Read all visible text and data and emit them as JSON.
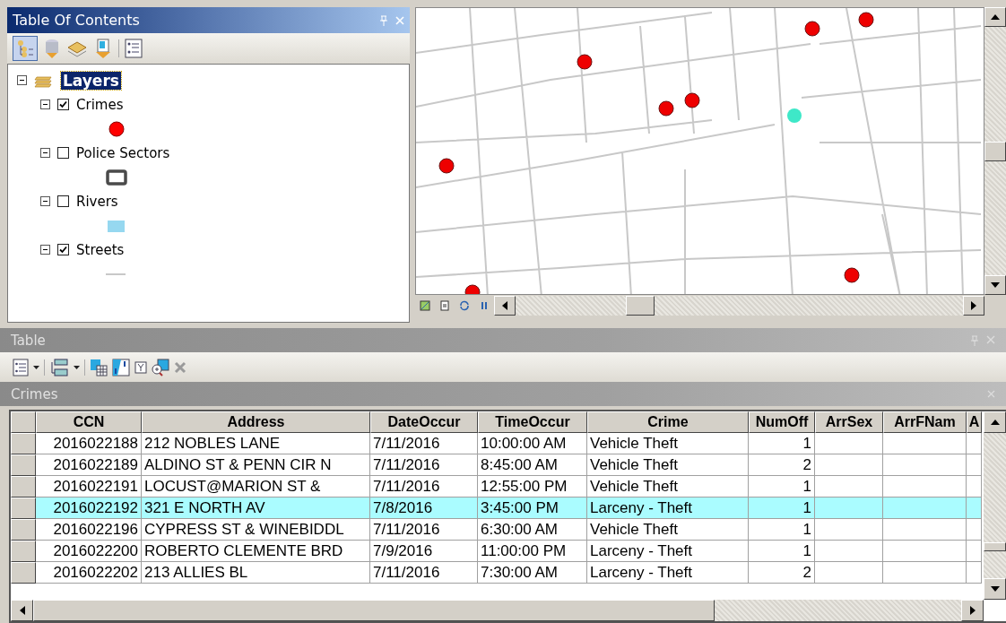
{
  "toc": {
    "title": "Table Of Contents",
    "root": {
      "label": "Layers",
      "selected": true,
      "expanded": true,
      "children": [
        {
          "label": "Crimes",
          "checked": true,
          "expanded": true,
          "symbol": {
            "kind": "point",
            "color": "#ff0000"
          }
        },
        {
          "label": "Police Sectors",
          "checked": false,
          "expanded": true,
          "symbol": {
            "kind": "outline",
            "color": "#4a4a4a"
          }
        },
        {
          "label": "Rivers",
          "checked": false,
          "expanded": true,
          "symbol": {
            "kind": "fill",
            "color": "#96d8f0"
          }
        },
        {
          "label": "Streets",
          "checked": true,
          "expanded": true,
          "symbol": {
            "kind": "line",
            "color": "#c8c8c8"
          }
        }
      ]
    }
  },
  "table_window": {
    "title": "Table",
    "layer_title": "Crimes",
    "columns": [
      {
        "label": "CCN",
        "kind": "number"
      },
      {
        "label": "Address",
        "kind": "text"
      },
      {
        "label": "DateOccur",
        "kind": "text"
      },
      {
        "label": "TimeOccur",
        "kind": "text"
      },
      {
        "label": "Crime",
        "kind": "text"
      },
      {
        "label": "NumOff",
        "kind": "number"
      },
      {
        "label": "ArrSex",
        "kind": "text"
      },
      {
        "label": "ArrFNam",
        "kind": "text"
      },
      {
        "label": "A",
        "kind": "text"
      }
    ],
    "rows": [
      {
        "selected": false,
        "cells": [
          "2016022188",
          "212 NOBLES LANE",
          "7/11/2016",
          "10:00:00 AM",
          "Vehicle Theft",
          "1",
          "",
          "",
          ""
        ]
      },
      {
        "selected": false,
        "cells": [
          "2016022189",
          "ALDINO ST  & PENN CIR N",
          "7/11/2016",
          "8:45:00 AM",
          "Vehicle Theft",
          "2",
          "",
          "",
          ""
        ]
      },
      {
        "selected": false,
        "cells": [
          "2016022191",
          "LOCUST@MARION ST  &",
          "7/11/2016",
          "12:55:00 PM",
          "Vehicle Theft",
          "1",
          "",
          "",
          ""
        ]
      },
      {
        "selected": true,
        "cells": [
          "2016022192",
          "321 E NORTH AV",
          "7/8/2016",
          "3:45:00 PM",
          "Larceny - Theft",
          "1",
          "",
          "",
          ""
        ]
      },
      {
        "selected": false,
        "cells": [
          "2016022196",
          "CYPRESS ST  & WINEBIDDL",
          "7/11/2016",
          "6:30:00 AM",
          "Vehicle Theft",
          "1",
          "",
          "",
          ""
        ]
      },
      {
        "selected": false,
        "cells": [
          "2016022200",
          "ROBERTO CLEMENTE BRD",
          "7/9/2016",
          "11:00:00 PM",
          "Larceny - Theft",
          "1",
          "",
          "",
          ""
        ]
      },
      {
        "selected": false,
        "cells": [
          "2016022202",
          "213 ALLIES BL",
          "7/11/2016",
          "7:30:00 AM",
          "Larceny - Theft",
          "2",
          "",
          "",
          ""
        ]
      }
    ]
  }
}
